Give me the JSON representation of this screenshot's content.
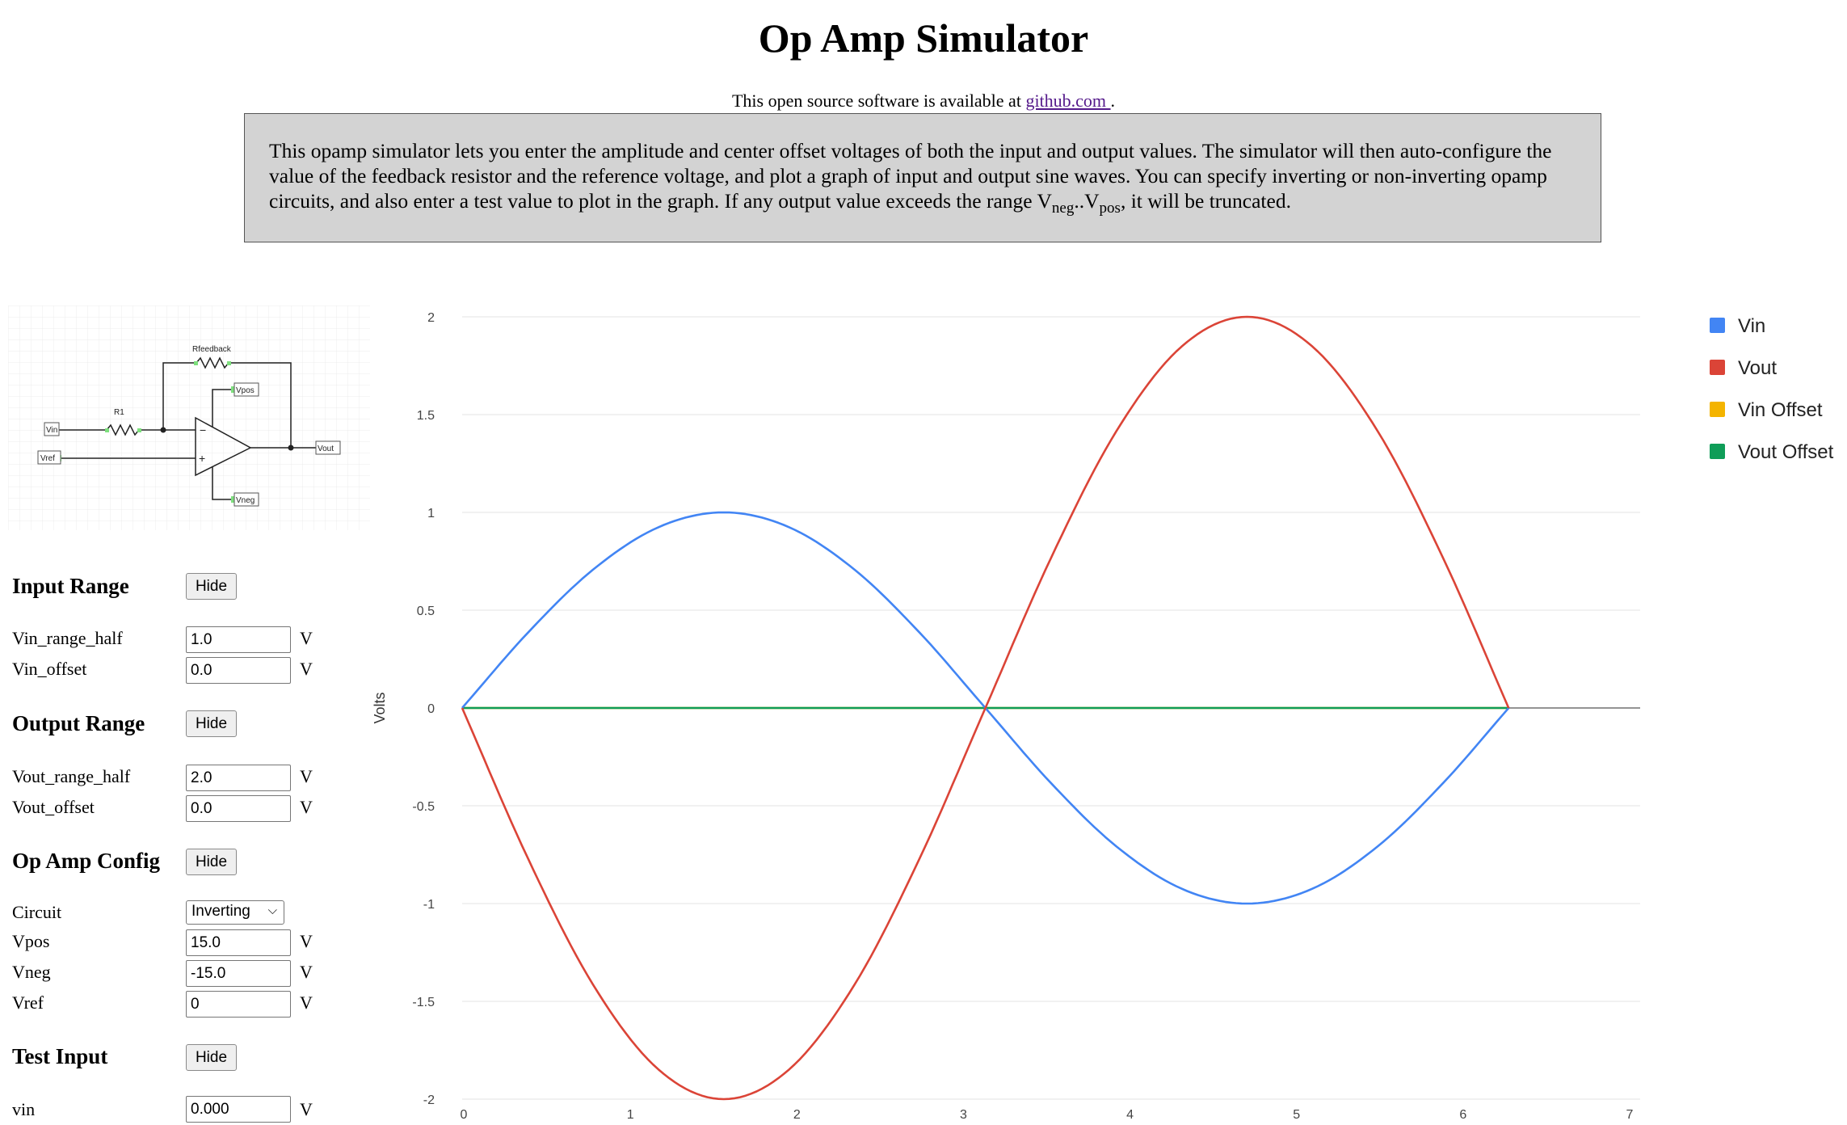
{
  "page": {
    "title": "Op Amp Simulator",
    "source_prefix": "This open source software is available at",
    "source_link": "github.com ",
    "source_suffix": ".",
    "description_main": "This opamp simulator lets you enter the amplitude and center offset voltages of both the input and output values. The simulator will then auto-configure the value of the feedback resistor and the reference voltage, and plot a graph of input and output sine waves. You can specify inverting or non-inverting opamp circuits, and also enter a test value to plot in the graph. If any output value exceeds the range V",
    "description_neg_sub": "neg",
    "description_dots": "..V",
    "description_pos_sub": "pos",
    "description_end": ", it will be truncated."
  },
  "schematic": {
    "labels": {
      "rfeedback": "Rfeedback",
      "r1": "R1",
      "vin": "Vin",
      "vref": "Vref",
      "vpos": "Vpos",
      "vneg": "Vneg",
      "vout": "Vout",
      "minus": "−",
      "plus": "+"
    }
  },
  "form": {
    "hide_label": "Hide",
    "unit": "V",
    "input_range": {
      "heading": "Input Range",
      "vin_range_half_label": "Vin_range_half",
      "vin_range_half_value": "1.0",
      "vin_offset_label": "Vin_offset",
      "vin_offset_value": "0.0"
    },
    "output_range": {
      "heading": "Output Range",
      "vout_range_half_label": "Vout_range_half",
      "vout_range_half_value": "2.0",
      "vout_offset_label": "Vout_offset",
      "vout_offset_value": "0.0"
    },
    "op_amp_config": {
      "heading": "Op Amp Config",
      "circuit_label": "Circuit",
      "circuit_value": "Inverting",
      "vpos_label": "Vpos",
      "vpos_value": "15.0",
      "vneg_label": "Vneg",
      "vneg_value": "-15.0",
      "vref_label": "Vref",
      "vref_value": "0"
    },
    "test_input": {
      "heading": "Test Input",
      "vin_label": "vin",
      "vin_value": "0.000"
    }
  },
  "chart_data": {
    "type": "line",
    "ylabel": "Volts",
    "xlim": [
      0,
      7
    ],
    "ylim": [
      -2,
      2
    ],
    "x_ticks": [
      "0",
      "1",
      "2",
      "3",
      "4",
      "5",
      "6",
      "7"
    ],
    "y_ticks": [
      "-2",
      "-1.5",
      "-1",
      "-0.5",
      "0",
      "0.5",
      "1",
      "1.5",
      "2"
    ],
    "grid": true,
    "legend_position": "right",
    "x": [
      0,
      0.3927,
      0.7854,
      1.1781,
      1.5708,
      1.9635,
      2.3562,
      2.7489,
      3.1416,
      3.5343,
      3.927,
      4.3197,
      4.7124,
      5.1051,
      5.4978,
      5.8905,
      6.2832
    ],
    "series": [
      {
        "name": "Vin",
        "color": "#4285f4",
        "values": [
          0,
          0.383,
          0.707,
          0.924,
          1.0,
          0.924,
          0.707,
          0.383,
          0,
          -0.383,
          -0.707,
          -0.924,
          -1.0,
          -0.924,
          -0.707,
          -0.383,
          0
        ]
      },
      {
        "name": "Vout",
        "color": "#db4437",
        "values": [
          0,
          -0.765,
          -1.414,
          -1.848,
          -2.0,
          -1.848,
          -1.414,
          -0.765,
          0,
          0.765,
          1.414,
          1.848,
          2.0,
          1.848,
          1.414,
          0.765,
          0
        ]
      },
      {
        "name": "Vin Offset",
        "color": "#f4b400",
        "values": [
          0,
          0,
          0,
          0,
          0,
          0,
          0,
          0,
          0,
          0,
          0,
          0,
          0,
          0,
          0,
          0,
          0
        ]
      },
      {
        "name": "Vout Offset",
        "color": "#0f9d58",
        "values": [
          0,
          0,
          0,
          0,
          0,
          0,
          0,
          0,
          0,
          0,
          0,
          0,
          0,
          0,
          0,
          0,
          0
        ]
      }
    ]
  }
}
